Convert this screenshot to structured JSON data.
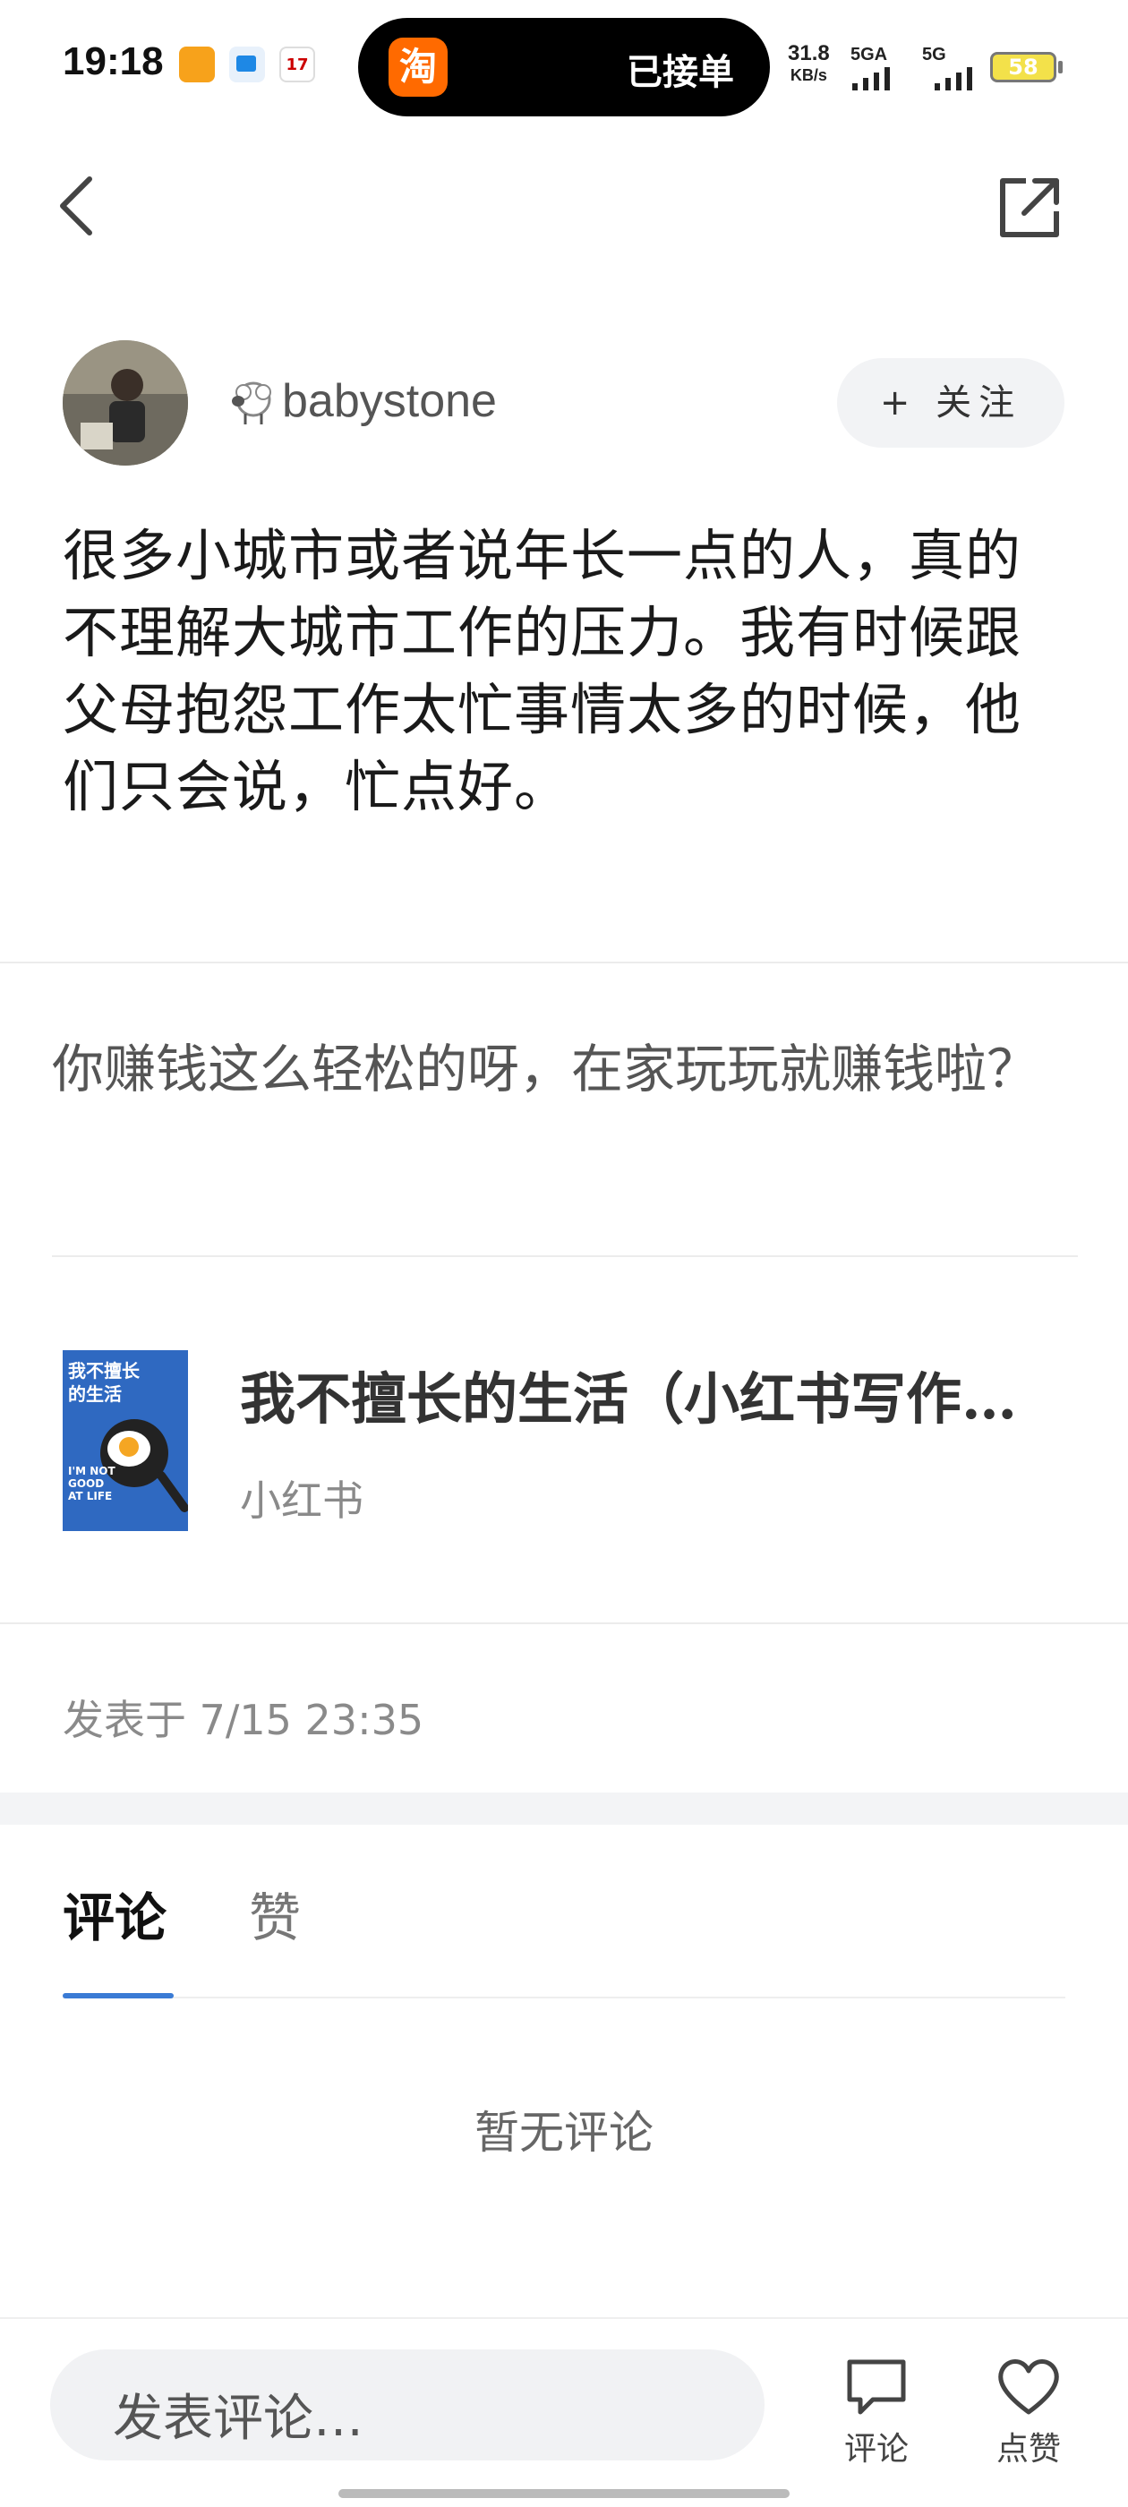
{
  "status": {
    "time": "19:18",
    "island_app": "淘",
    "island_text": "已接单",
    "net_speed": "31.8",
    "net_unit": "KB/s",
    "signal1": "5GA",
    "signal2": "5G",
    "battery": "58"
  },
  "author": {
    "name": "babystone",
    "follow_label": "+ 关注"
  },
  "post": {
    "text": "很多小城市或者说年长一点的人，真的不理解大城市工作的压力。我有时候跟父母抱怨工作太忙事情太多的时候，他们只会说，忙点好。",
    "quote": "你赚钱这么轻松的呀，在家玩玩就赚钱啦？",
    "book": {
      "title": "我不擅长的生活（小红书写作…",
      "source": "小红书",
      "cover_title": "我不擅长\n的生活",
      "cover_en": "I'M NOT\nGOOD\nAT LIFE"
    },
    "timestamp": "发表于 7/15 23:35"
  },
  "tabs": {
    "comments": "评论",
    "likes": "赞"
  },
  "comments": {
    "empty_text": "暂无评论"
  },
  "bottom": {
    "input_placeholder": "发表评论…",
    "comment_label": "评论",
    "like_label": "点赞"
  },
  "colors": {
    "accent": "#3a7bd5",
    "taobao": "#ff6a00"
  }
}
